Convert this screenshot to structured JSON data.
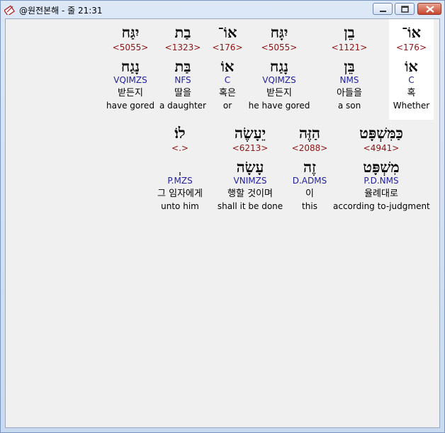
{
  "window": {
    "title": "@원전본해 - 줄 21:31"
  },
  "rows": [
    {
      "words": [
        {
          "id": "w1",
          "hebrew": "יִגַּח",
          "strong": "<5055>",
          "lemma": "נָגַח",
          "morph": "VQIMZS",
          "korean": "받든지",
          "english": "have gored"
        },
        {
          "id": "w2",
          "hebrew": "בַת",
          "strong": "<1323>",
          "lemma": "בַּת",
          "morph": "NFS",
          "korean": "딸을",
          "english": "a daughter"
        },
        {
          "id": "w3",
          "hebrew": "אוֹ־",
          "strong": "<176>",
          "lemma": "אוֹ",
          "morph": "C",
          "korean": "혹은",
          "english": "or"
        },
        {
          "id": "w4",
          "hebrew": "יִגָּח",
          "strong": "<5055>",
          "lemma": "נָגַח",
          "morph": "VQIMZS",
          "korean": "받든지",
          "english": "he have gored"
        },
        {
          "id": "w5",
          "hebrew": "בֵן",
          "strong": "<1121>",
          "lemma": "בֵּן",
          "morph": "NMS",
          "korean": "아들을",
          "english": "a son"
        },
        {
          "id": "w6",
          "hebrew": "אוֹ־",
          "strong": "<176>",
          "lemma": "אוֹ",
          "morph": "C",
          "korean": "혹",
          "english": "Whether"
        }
      ]
    },
    {
      "words": [
        {
          "id": "w7",
          "hebrew": "לוֹ׃",
          "strong": "<.>",
          "lemma": "ְ",
          "morph": "P.MZS",
          "korean": "그 임자에게",
          "english": "unto him"
        },
        {
          "id": "w8",
          "hebrew": "יֵעָשֶׂה",
          "strong": "<6213>",
          "lemma": "עָשָׂה",
          "morph": "VNIMZS",
          "korean": "행할 것이며",
          "english": "shall it be done"
        },
        {
          "id": "w9",
          "hebrew": "הַזֶּה",
          "strong": "<2088>",
          "lemma": "זֶה",
          "morph": "D.ADMS",
          "korean": "이",
          "english": "this"
        },
        {
          "id": "w10",
          "hebrew": "כַּמִּשְׁפָּט",
          "strong": "<4941>",
          "lemma": "מִשְׁפָּט",
          "morph": "P.D.NMS",
          "korean": "율례대로",
          "english": "according to-judgment"
        }
      ]
    }
  ]
}
